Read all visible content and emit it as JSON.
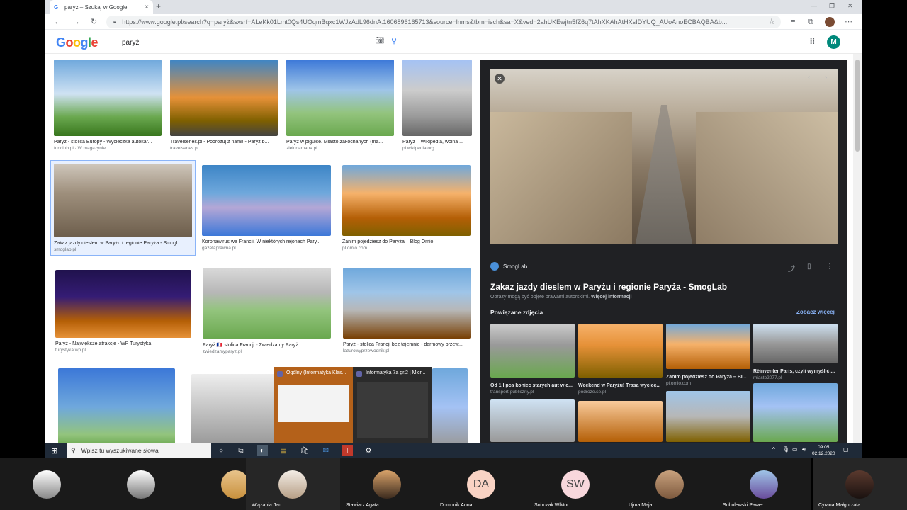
{
  "browser": {
    "tab_title": "paryż – Szukaj w Google",
    "url": "https://www.google.pl/search?q=paryż&sxsrf=ALeKk01Lmt0Qs4UOqmBqxc1WJzAdL96dnA:1606896165713&source=lnms&tbm=isch&sa=X&ved=2ahUKEwjtn5fZ6q7tAhXKAhAtHXsIDYUQ_AUoAnoECBAQBA&b..."
  },
  "google": {
    "logo": [
      "G",
      "o",
      "o",
      "g",
      "l",
      "e"
    ],
    "logo_colors": [
      "#4285f4",
      "#ea4335",
      "#fbbc05",
      "#4285f4",
      "#34a853",
      "#ea4335"
    ],
    "query": "paryż",
    "user_initial": "M"
  },
  "results": [
    {
      "caption": "Paryż - stolica Europy - Wycieczka autokar...",
      "source": "funclub.pl · W magazynie"
    },
    {
      "caption": "Travelseries.pl - Podróżuj z nami! - Paryż b...",
      "source": "travelseries.pl"
    },
    {
      "caption": "Paryż w pigułce. Miasto zakochanych (ma...",
      "source": "zielonamapa.pl"
    },
    {
      "caption": "Paryż – Wikipedia, wolna ...",
      "source": "pl.wikipedia.org"
    },
    {
      "caption": "Zakaz jazdy dieslem w Paryżu i regionie Paryża - SmogL...",
      "source": "smoglab.pl"
    },
    {
      "caption": "Koronawirus we Francji. W niektórych rejonach Pary...",
      "source": "gazetaprawna.pl"
    },
    {
      "caption": "Zanim pojedziesz do Paryża – Blog Omio",
      "source": "pl.omio.com"
    },
    {
      "caption": "Paryż - Największe atrakcje - WP Turystyka",
      "source": "turystyka.wp.pl"
    },
    {
      "caption": "Paryż 🇫🇷 stolica Francji - Zwiedzamy Paryż",
      "source": "zwiedzamyparyz.pl"
    },
    {
      "caption": "Paryż - stolica Francji bez tajemnic - darmowy przew...",
      "source": "lazurowyprzewodnik.pl"
    }
  ],
  "panel": {
    "source_name": "SmogLab",
    "title": "Zakaz jazdy dieslem w Paryżu i regionie Paryża - SmogLab",
    "note": "Obrazy mogą być objęte prawami autorskimi.",
    "note_link": "Więcej informacji",
    "related_heading": "Powiązane zdjęcia",
    "related_more": "Zobacz więcej",
    "related": [
      {
        "caption": "Od 1 lipca koniec starych aut w c...",
        "source": "transport-publiczny.pl"
      },
      {
        "caption": "Weekend w Paryżu! Trasa wyciec...",
        "source": "podroze.se.pl"
      },
      {
        "caption": "Zanim pojedziesz do Paryża – Bl...",
        "source": "pl.omio.com"
      },
      {
        "caption": "Réinventer Paris, czyli wymyślić ...",
        "source": "miasto2077.pl"
      }
    ]
  },
  "preview": {
    "left_title": "Ogólny (Informatyka Klas...",
    "right_title": "Informatyka 7a gr.2 | Micr..."
  },
  "taskbar": {
    "search_placeholder": "Wpisz tu wyszukiwane słowa",
    "time": "09:05",
    "date": "02.12.2020"
  },
  "participants": [
    {
      "name": "",
      "initials": ""
    },
    {
      "name": "",
      "initials": ""
    },
    {
      "name": "",
      "initials": ""
    },
    {
      "name": "Wiązania Jan",
      "initials": ""
    },
    {
      "name": "Stawiarz Agata",
      "initials": ""
    },
    {
      "name": "Domonik Anna",
      "initials": "DA"
    },
    {
      "name": "Sobczak Wiktor",
      "initials": "SW"
    },
    {
      "name": "Ujma Maja",
      "initials": ""
    },
    {
      "name": "Sobolewski Paweł",
      "initials": ""
    },
    {
      "name": "Cyrana Małgorzata",
      "initials": ""
    }
  ]
}
